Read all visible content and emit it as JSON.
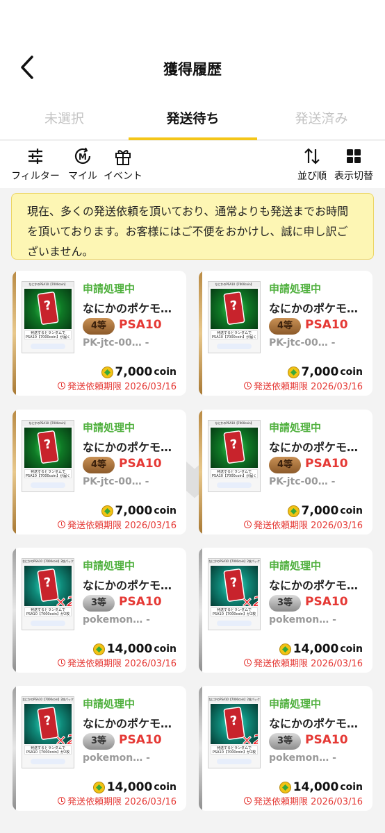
{
  "header": {
    "title": "獲得履歴"
  },
  "tabs": [
    {
      "label": "未選択"
    },
    {
      "label": "発送待ち"
    },
    {
      "label": "発送済み"
    }
  ],
  "toolbar": {
    "filter": "フィルター",
    "mile": "マイル",
    "event": "イベント",
    "sort": "並び順",
    "view": "表示切替"
  },
  "notice": "現在、多くの発送依頼を頂いており、通常よりも発送までお時間を頂いております。お客様にはご不便をおかけし、誠に申し訳ございません。",
  "colors": {
    "accent": "#f4c619",
    "status": "#4fb03d",
    "danger": "#e53935",
    "notice_bg": "#fdf6b4"
  },
  "cards": [
    {
      "status": "申請処理中",
      "name": "なにかのポケモ…",
      "grade": "4等",
      "psa": "PSA10",
      "code": "PK-jtc-00…",
      "dash": "-",
      "price": "7,000",
      "unit": "coin",
      "deadline": "発送依頼期限 2026/03/16",
      "thumb_top": "なにかのPSA10【7000coin】",
      "thumb_mid": "発送するとランダムで PSA10【7000coin】が届く",
      "multi": ""
    },
    {
      "status": "申請処理中",
      "name": "なにかのポケモ…",
      "grade": "4等",
      "psa": "PSA10",
      "code": "PK-jtc-00…",
      "dash": "-",
      "price": "7,000",
      "unit": "coin",
      "deadline": "発送依頼期限 2026/03/16",
      "thumb_top": "なにかのPSA10【7000coin】",
      "thumb_mid": "発送するとランダムで PSA10【7000coin】が届く",
      "multi": ""
    },
    {
      "status": "申請処理中",
      "name": "なにかのポケモ…",
      "grade": "4等",
      "psa": "PSA10",
      "code": "PK-jtc-00…",
      "dash": "-",
      "price": "7,000",
      "unit": "coin",
      "deadline": "発送依頼期限 2026/03/16",
      "thumb_top": "なにかのPSA10【7000coin】",
      "thumb_mid": "発送するとランダムで PSA10【7000coin】が届く",
      "multi": ""
    },
    {
      "status": "申請処理中",
      "name": "なにかのポケモ…",
      "grade": "4等",
      "psa": "PSA10",
      "code": "PK-jtc-00…",
      "dash": "-",
      "price": "7,000",
      "unit": "coin",
      "deadline": "発送依頼期限 2026/03/16",
      "thumb_top": "なにかのPSA10【7000coin】",
      "thumb_mid": "発送するとランダムで PSA10【7000coin】が届く",
      "multi": ""
    },
    {
      "status": "申請処理中",
      "name": "なにかのポケモ…",
      "grade": "3等",
      "psa": "PSA10",
      "code": "pokemon…",
      "dash": "-",
      "price": "14,000",
      "unit": "coin",
      "deadline": "発送依頼期限 2026/03/16",
      "thumb_top": "なにかのPSA10【7000coin】2枚パック",
      "thumb_mid": "発送するとランダムで PSA10【7000coin】が2枚届く",
      "multi": "×2"
    },
    {
      "status": "申請処理中",
      "name": "なにかのポケモ…",
      "grade": "3等",
      "psa": "PSA10",
      "code": "pokemon…",
      "dash": "-",
      "price": "14,000",
      "unit": "coin",
      "deadline": "発送依頼期限 2026/03/16",
      "thumb_top": "なにかのPSA10【7000coin】2枚パック",
      "thumb_mid": "発送するとランダムで PSA10【7000coin】が2枚届く",
      "multi": "×2"
    },
    {
      "status": "申請処理中",
      "name": "なにかのポケモ…",
      "grade": "3等",
      "psa": "PSA10",
      "code": "pokemon…",
      "dash": "-",
      "price": "14,000",
      "unit": "coin",
      "deadline": "発送依頼期限 2026/03/16",
      "thumb_top": "なにかのPSA10【7000coin】2枚パック",
      "thumb_mid": "発送するとランダムで PSA10【7000coin】が2枚届く",
      "multi": "×2"
    },
    {
      "status": "申請処理中",
      "name": "なにかのポケモ…",
      "grade": "3等",
      "psa": "PSA10",
      "code": "pokemon…",
      "dash": "-",
      "price": "14,000",
      "unit": "coin",
      "deadline": "発送依頼期限 2026/03/16",
      "thumb_top": "なにかのPSA10【7000coin】2枚パック",
      "thumb_mid": "発送するとランダムで PSA10【7000coin】が2枚届く",
      "multi": "×2"
    }
  ]
}
